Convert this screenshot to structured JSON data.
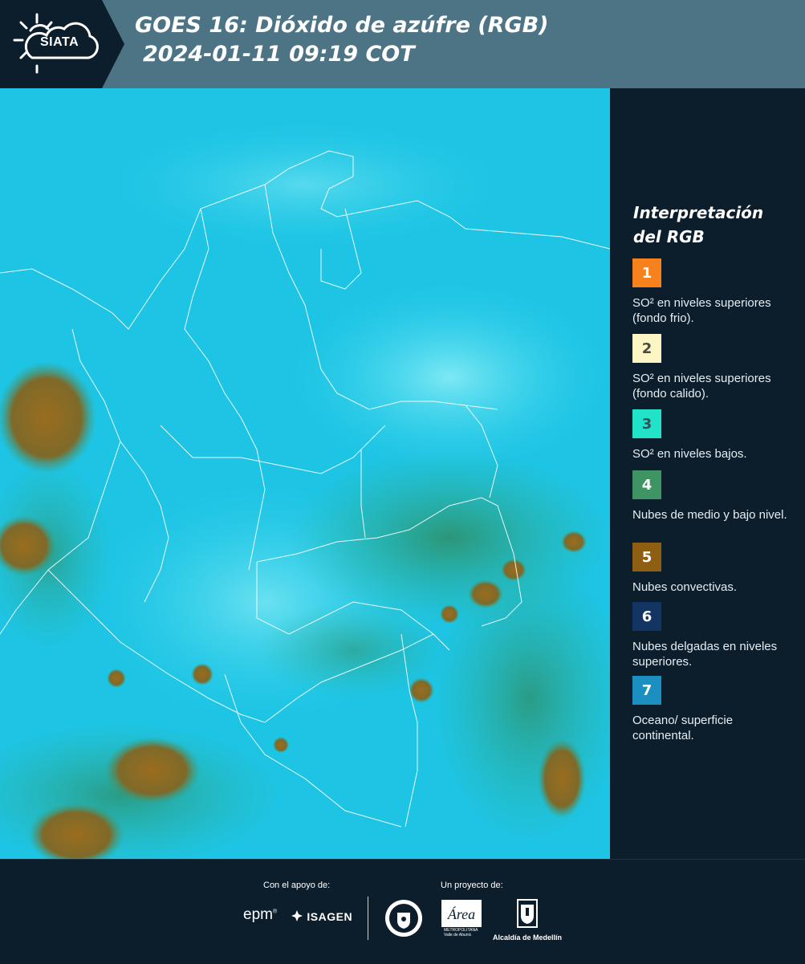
{
  "header": {
    "logo_text": "SIATA",
    "title_line1": "GOES 16: Dióxido de azúfre (RGB)",
    "title_line2": "2024-01-11 09:19 COT"
  },
  "legend": {
    "title_line1": "Interpretación",
    "title_line2": "del RGB",
    "items": [
      {
        "number": "1",
        "color": "#f7811d",
        "text_color": "#ffffff",
        "description": "SO² en niveles superiores (fondo frio)."
      },
      {
        "number": "2",
        "color": "#fdf6c4",
        "text_color": "#4a4a4a",
        "description": "SO² en niveles superiores (fondo calido)."
      },
      {
        "number": "3",
        "color": "#21e3c8",
        "text_color": "#34515c",
        "description": "SO² en niveles bajos."
      },
      {
        "number": "4",
        "color": "#3f9463",
        "text_color": "#ffffff",
        "description": "Nubes de medio y bajo nivel."
      },
      {
        "number": "5",
        "color": "#8e5e13",
        "text_color": "#ffffff",
        "description": "Nubes convectivas."
      },
      {
        "number": "6",
        "color": "#123563",
        "text_color": "#ffffff",
        "description": "Nubes delgadas en niveles superiores."
      },
      {
        "number": "7",
        "color": "#1a8fc0",
        "text_color": "#ffffff",
        "description": "Oceano/ superficie continental."
      }
    ]
  },
  "footer": {
    "support_label": "Con el apoyo de:",
    "project_label": "Un proyecto de:",
    "epm": "epm",
    "isagen": "ISAGEN",
    "area_name": "Área",
    "area_line1": "METROPOLITANA",
    "area_line2": "Valle de Aburrá",
    "alcaldia": "Alcaldía de Medellín"
  },
  "colors": {
    "background": "#0c1e2c",
    "header": "#4d7485",
    "map_base": "#1ec8e6",
    "map_cloud": "#8e6a1e",
    "map_green": "#3d9c6a"
  }
}
